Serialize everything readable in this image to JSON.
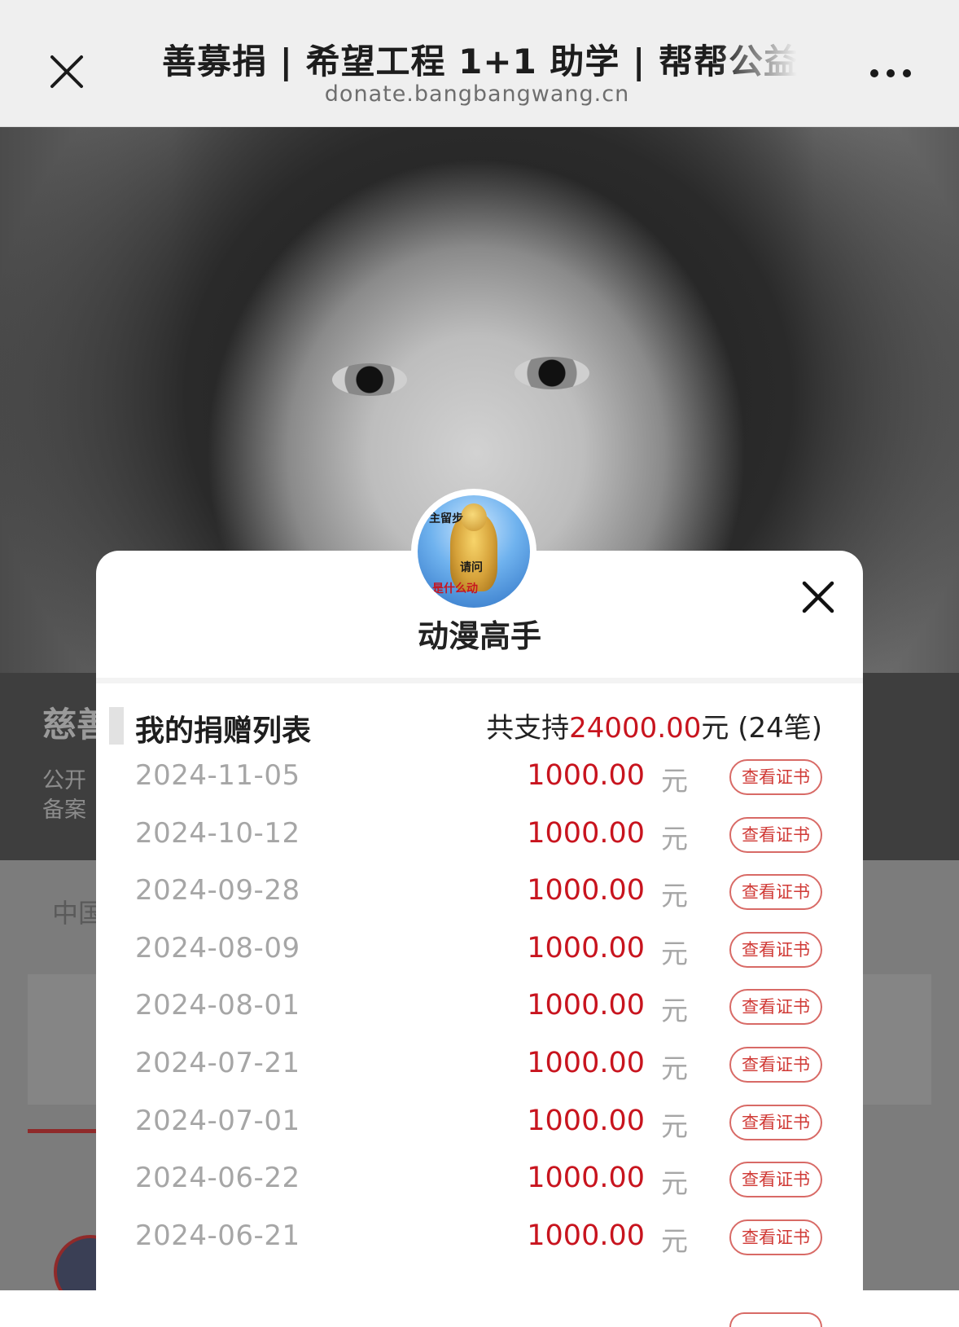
{
  "browser": {
    "title": "善募捐 | 希望工程 1+1 助学 | 帮帮公益",
    "url": "donate.bangbangwang.cn"
  },
  "background_page": {
    "title_fragment": "慈善",
    "subtitle_line1": "公开",
    "subtitle_line2": "备案",
    "org_fragment": "中国"
  },
  "modal": {
    "user_name": "动漫高手",
    "avatar_text_top": "主留步",
    "avatar_text_mid": "请问",
    "avatar_text_bottom": "是什么动",
    "list_title": "我的捐赠列表",
    "summary_prefix": "共支持",
    "summary_amount": "24000.00",
    "summary_suffix": "元 (24笔)",
    "currency_unit": "元",
    "certificate_label": "查看证书",
    "donations": [
      {
        "date": "2024-11-05",
        "amount": "1000.00"
      },
      {
        "date": "2024-10-12",
        "amount": "1000.00"
      },
      {
        "date": "2024-09-28",
        "amount": "1000.00"
      },
      {
        "date": "2024-08-09",
        "amount": "1000.00"
      },
      {
        "date": "2024-08-01",
        "amount": "1000.00"
      },
      {
        "date": "2024-07-21",
        "amount": "1000.00"
      },
      {
        "date": "2024-07-01",
        "amount": "1000.00"
      },
      {
        "date": "2024-06-22",
        "amount": "1000.00"
      },
      {
        "date": "2024-06-21",
        "amount": "1000.00"
      }
    ]
  },
  "colors": {
    "accent_red": "#c8141e",
    "muted_gray": "#a6a6a6",
    "button_border": "#d86a66"
  },
  "icons": {
    "close": "close-icon",
    "more": "more-dots-icon",
    "modal_close": "modal-close-icon"
  }
}
